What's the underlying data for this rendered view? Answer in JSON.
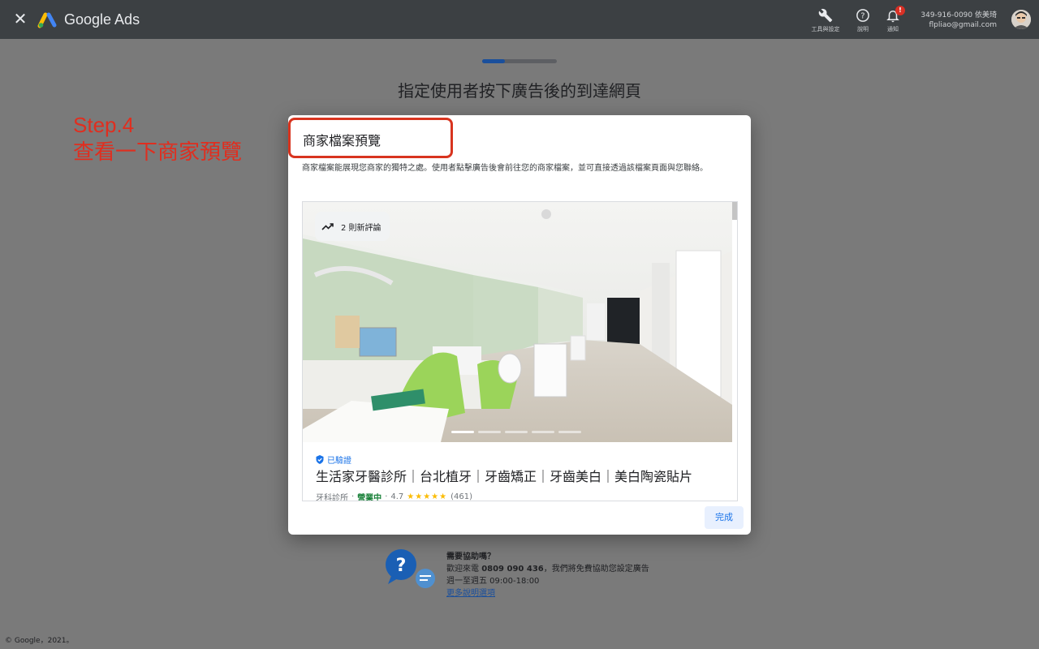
{
  "topbar": {
    "brand": "Google Ads",
    "tools": [
      {
        "label": "工具與設定",
        "icon": "wrench-icon"
      },
      {
        "label": "說明",
        "icon": "help-icon"
      },
      {
        "label": "通知",
        "icon": "bell-icon",
        "badge": "!"
      }
    ],
    "account_id": "349-916-0090 依美琦",
    "account_email": "flpliao@gmail.com"
  },
  "page": {
    "title": "指定使用者按下廣告後的到達網頁",
    "progress": 0.3
  },
  "annotation": {
    "line1": "Step.4",
    "line2": "查看一下商家預覽"
  },
  "modal": {
    "title": "商家檔案預覽",
    "description": "商家檔案能展現您商家的獨特之處。使用者點擊廣告後會前往您的商家檔案，並可直接透過該檔案頁面與您聯絡。",
    "reviews_chip": "2 則新評論",
    "verified": "已驗證",
    "business_name": "生活家牙醫診所｜台北植牙｜牙齒矯正｜牙齒美白｜美白陶瓷貼片",
    "category": "牙科診所",
    "status": "營業中",
    "rating": "4.7",
    "stars": "★★★★★",
    "review_count": "(461)",
    "done_button": "完成"
  },
  "help": {
    "heading": "需要協助嗎？",
    "line1_prefix": "歡迎來電 ",
    "phone": "0809 090 436",
    "line1_suffix": "，我們將免費協助您設定廣告",
    "hours": "週一至週五 09:00-18:00",
    "link": "更多說明選項"
  },
  "footer": "© Google，2021。",
  "colors": {
    "overlay": "#7a7a7a",
    "topbar": "#3c4043",
    "annotation_red": "#e02e1f",
    "accent_blue": "#1a73e8"
  }
}
